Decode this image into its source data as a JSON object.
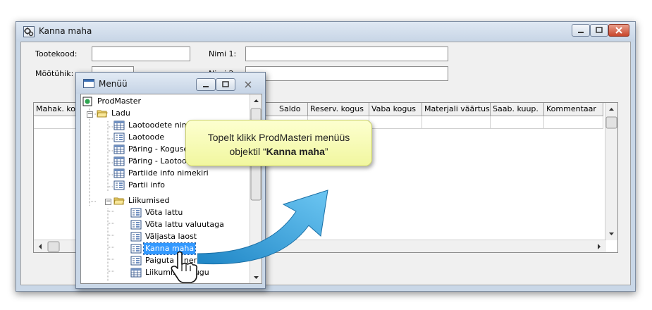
{
  "main_window": {
    "title": "Kanna maha",
    "fields": {
      "tootekood_label": "Tootekood:",
      "tootekood_value": "",
      "nimi1_label": "Nimi 1:",
      "nimi1_value": "",
      "mootuhik_label": "Mõõtühik:",
      "nimi2_label": "Nimi 2:"
    },
    "grid": {
      "columns": [
        "Mahak. ko",
        "Saldo",
        "Reserv. kogus",
        "Vaba kogus",
        "Materjali väärtus",
        "Saab. kuup.",
        "Kommentaar"
      ]
    }
  },
  "menu_window": {
    "title": "Menüü",
    "tree": {
      "root": "ProdMaster",
      "ladu": "Ladu",
      "ladu_items": [
        "Laotoodete nime",
        "Laotoode",
        "Päring - Koguse",
        "Päring - Laotood",
        "Partiide info nimekiri",
        "Partii info"
      ],
      "liikumised": "Liikumised",
      "liikumised_items": [
        "Võta lattu",
        "Võta lattu valuutaga",
        "Väljasta laost",
        "Kanna maha",
        "Paiguta    ner",
        "Liikumiste    ugu"
      ],
      "selected": "Kanna maha"
    }
  },
  "tooltip": {
    "line1": "Topelt klikk ProdMasteri menüüs",
    "line2_prefix": "objektil “",
    "line2_bold": "Kanna maha",
    "line2_suffix": "”"
  },
  "colors": {
    "selection": "#3399ff",
    "tooltip_bg": "#f6f9b8",
    "arrow": "#2a9ad8",
    "close_button": "#c8452b"
  }
}
